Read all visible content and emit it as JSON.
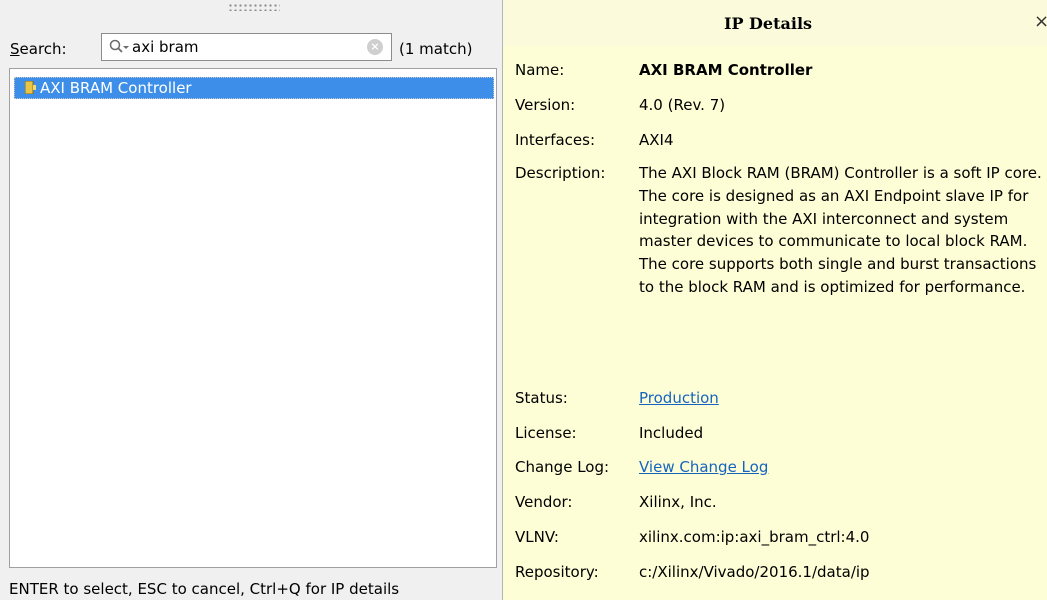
{
  "search": {
    "label_mnemonic": "S",
    "label_rest": "earch:",
    "value": "axi bram",
    "match_count": "(1 match)"
  },
  "results": [
    {
      "label": "AXI BRAM Controller",
      "icon": "ip-core-icon",
      "selected": true
    }
  ],
  "hint": "ENTER to select, ESC to cancel, Ctrl+Q for IP details",
  "details": {
    "title": "IP Details",
    "close": "×",
    "fields": {
      "name": {
        "label": "Name:",
        "value": "AXI BRAM Controller"
      },
      "version": {
        "label": "Version:",
        "value": "4.0 (Rev. 7)"
      },
      "interfaces": {
        "label": "Interfaces:",
        "value": "AXI4"
      },
      "description": {
        "label": "Description:",
        "value": "The AXI Block RAM (BRAM) Controller is a soft IP core. The core is designed as an AXI Endpoint slave IP for integration with the AXI interconnect and system master devices to communicate to local block RAM. The core supports both single and burst transactions to the block RAM and is optimized for performance."
      },
      "status": {
        "label": "Status:",
        "value": "Production"
      },
      "license": {
        "label": "License:",
        "value": "Included"
      },
      "change_log": {
        "label": "Change Log:",
        "value": "View Change Log"
      },
      "vendor": {
        "label": "Vendor:",
        "value": "Xilinx, Inc."
      },
      "vlnv": {
        "label": "VLNV:",
        "value": "xilinx.com:ip:axi_bram_ctrl:4.0"
      },
      "repository": {
        "label": "Repository:",
        "value": "c:/Xilinx/Vivado/2016.1/data/ip"
      }
    }
  },
  "colors": {
    "selection": "#3d8ee8",
    "details_background": "#fdfdd6",
    "link": "#1565c0"
  }
}
